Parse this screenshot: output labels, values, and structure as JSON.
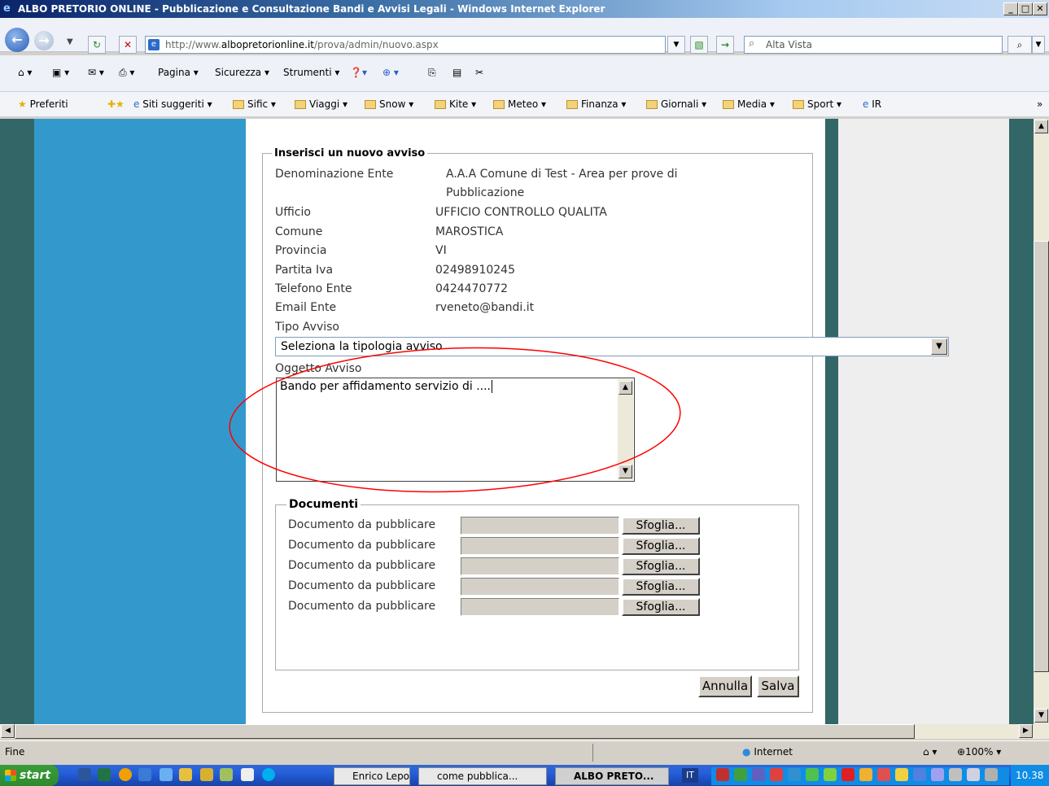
{
  "window": {
    "title": "ALBO PRETORIO ONLINE - Pubblicazione e Consultazione Bandi e Avvisi Legali - Windows Internet Explorer",
    "min": "_",
    "max": "□",
    "close": "✕"
  },
  "nav": {
    "url_prefix": "http://www.",
    "url_domain": "albopretorionline.it",
    "url_path": "/prova/admin/nuovo.aspx",
    "search_placeholder": "Alta Vista"
  },
  "commands": [
    "Pagina ▾",
    "Sicurezza ▾",
    "Strumenti ▾"
  ],
  "favorites": {
    "label": "Preferiti",
    "items": [
      "Siti suggeriti ▾",
      "Sific ▾",
      "Viaggi ▾",
      "Snow ▾",
      "Kite ▾",
      "Meteo ▾",
      "Finanza ▾",
      "Giornali ▾",
      "Media ▾",
      "Sport ▾",
      "IR"
    ],
    "more": "»"
  },
  "form": {
    "legend": "Inserisci un nuovo avviso",
    "fields": [
      {
        "label": "Denominazione Ente",
        "value": "A.A.A Comune di Test - Area per prove di",
        "value2": "Pubblicazione"
      },
      {
        "label": "Ufficio",
        "value": "UFFICIO CONTROLLO QUALITA"
      },
      {
        "label": "Comune",
        "value": "MAROSTICA"
      },
      {
        "label": "Provincia",
        "value": "VI"
      },
      {
        "label": "Partita Iva",
        "value": "02498910245"
      },
      {
        "label": "Telefono Ente",
        "value": "0424470772"
      },
      {
        "label": "Email Ente",
        "value": "rveneto@bandi.it"
      }
    ],
    "tipo_label": "Tipo Avviso",
    "tipo_selected": "Seleziona la tipologia avviso",
    "oggetto_label": "Oggetto Avviso",
    "oggetto_value": "Bando per affidamento servizio di ....",
    "documenti_legend": "Documenti",
    "documenti": [
      {
        "label": "Documento da pubblicare",
        "button": "Sfoglia..."
      },
      {
        "label": "Documento da pubblicare",
        "button": "Sfoglia..."
      },
      {
        "label": "Documento da pubblicare",
        "button": "Sfoglia..."
      },
      {
        "label": "Documento da pubblicare",
        "button": "Sfoglia..."
      },
      {
        "label": "Documento da pubblicare",
        "button": "Sfoglia..."
      }
    ],
    "annulla": "Annulla",
    "salva": "Salva"
  },
  "status": {
    "text": "Fine",
    "zone": "Internet",
    "zoom": "100%"
  },
  "taskbar": {
    "start": "start",
    "tasks": [
      "Enrico Lepora...",
      "come pubblica...",
      "ALBO PRETO..."
    ],
    "lang": "IT",
    "clock": "10.38"
  },
  "colors": {
    "page_bg": "#336666",
    "left_column": "#3399cc",
    "annotation": "#ff0000"
  }
}
